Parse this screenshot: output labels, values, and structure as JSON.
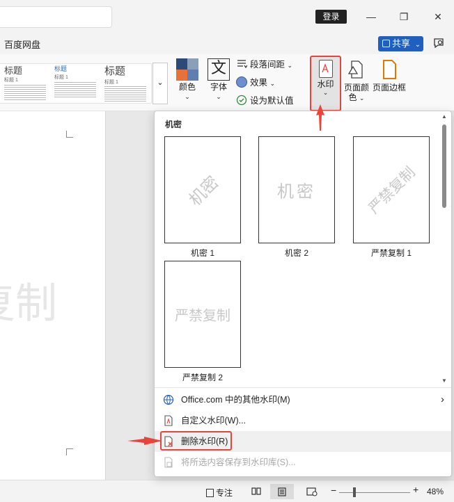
{
  "titlebar": {
    "login_label": "登录",
    "minimize_glyph": "—",
    "restore_glyph": "❐",
    "close_glyph": "✕"
  },
  "ribbon": {
    "tab_baidu": "百度网盘",
    "share_label": "共享",
    "share_caret": "⌄",
    "styles": [
      {
        "big": "标题",
        "small": "标题 1"
      },
      {
        "mid": "标题",
        "small": "标题 1"
      },
      {
        "big": "标题",
        "small": "标题 1"
      }
    ],
    "gallery_more": "⌄",
    "colors_label": "颜色",
    "font_label": "字体",
    "font_glyph": "文",
    "paragraph_spacing_label": "段落间距",
    "effects_label": "效果",
    "set_default_label": "设为默认值",
    "watermark_label": "水印",
    "page_color_label1": "页面颜",
    "page_color_label2": "色",
    "page_border_label": "页面边框",
    "caret": "⌄",
    "colors": {
      "accent_red": "#e8443a",
      "share_blue": "#1f5fbf"
    }
  },
  "document": {
    "watermark_text": "复制"
  },
  "menu": {
    "section_title": "机密",
    "items": [
      {
        "caption": "机密 1",
        "text": "机密",
        "style": "diagonal"
      },
      {
        "caption": "机密 2",
        "text": "机密",
        "style": "horizontal"
      },
      {
        "caption": "严禁复制 1",
        "text": "严禁复制",
        "style": "diagonal"
      },
      {
        "caption": "严禁复制 2",
        "text": "严禁复制",
        "style": "horizontal"
      }
    ],
    "more_watermarks": "Office.com 中的其他水印(M)",
    "custom_watermark": "自定义水印(W)...",
    "remove_watermark": "删除水印(R)",
    "save_to_gallery": "将所选内容保存到水印库(S)...",
    "submenu_arrow": "›",
    "scroll_up": "▲",
    "scroll_down": "▼"
  },
  "statusbar": {
    "focus_label": "专注",
    "zoom_minus": "−",
    "zoom_plus": "+",
    "zoom_level": "48%"
  }
}
